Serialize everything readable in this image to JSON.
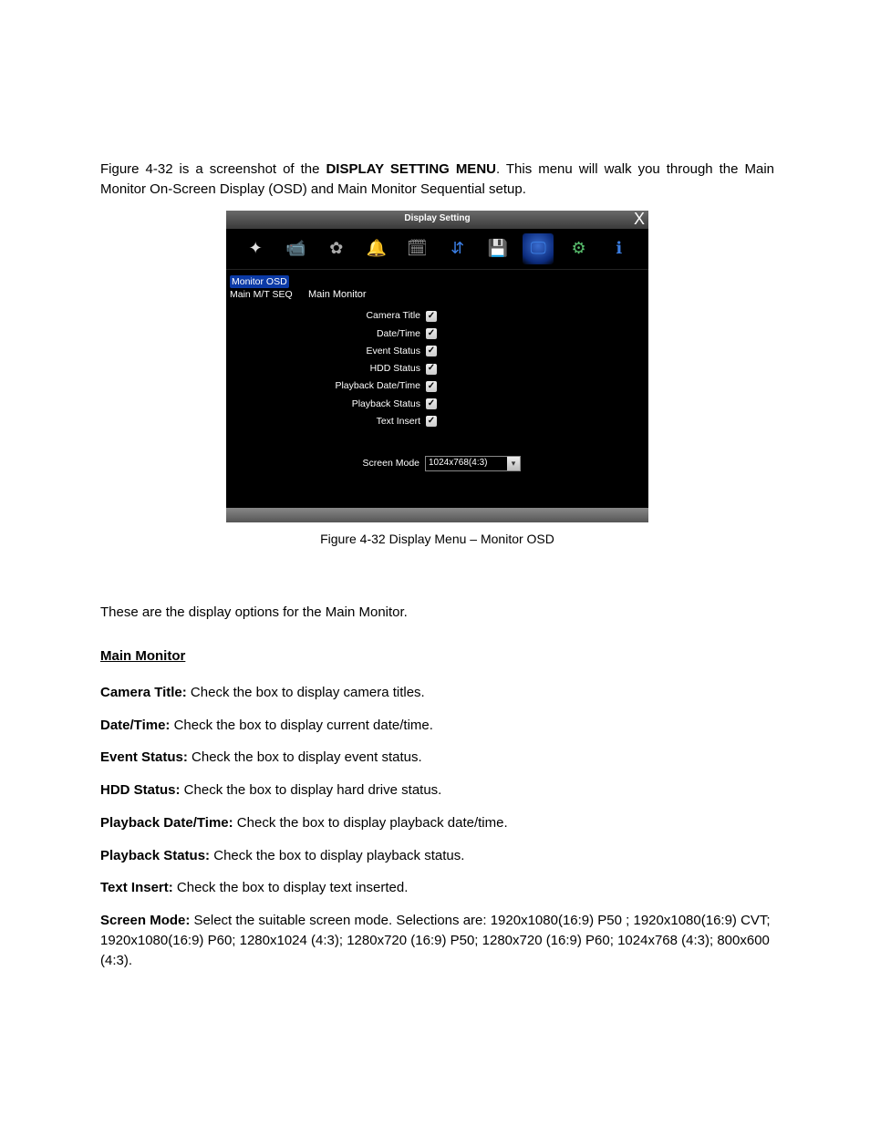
{
  "intro": {
    "prefix": "Figure 4-32 is a screenshot of the ",
    "bold": "DISPLAY SETTING MENU",
    "suffix": ". This menu will walk you through the Main Monitor On-Screen Display (OSD) and Main Monitor Sequential setup."
  },
  "app": {
    "title": "Display Setting",
    "close": "X",
    "sidebar": {
      "monitor_osd": "Monitor OSD",
      "main_mt_seq": "Main M/T SEQ"
    },
    "main_title": "Main Monitor",
    "options": {
      "camera_title": "Camera Title",
      "date_time": "Date/Time",
      "event_status": "Event Status",
      "hdd_status": "HDD Status",
      "playback_date_time": "Playback Date/Time",
      "playback_status": "Playback Status",
      "text_insert": "Text Insert"
    },
    "screen_mode_label": "Screen Mode",
    "screen_mode_value": "1024x768(4:3)"
  },
  "caption": "Figure 4-32 Display Menu – Monitor OSD",
  "para_intro": "These are the display options for the Main Monitor.",
  "heading": "Main Monitor",
  "defs": {
    "camera_title": {
      "label": "Camera Title:",
      "desc": " Check the box to display camera titles."
    },
    "date_time": {
      "label": "Date/Time:",
      "desc": " Check the box to display current date/time."
    },
    "event_status": {
      "label": "Event Status:",
      "desc": " Check the box to display event status."
    },
    "hdd_status": {
      "label": "HDD Status:",
      "desc": " Check the box to display hard drive status."
    },
    "playback_date_time": {
      "label": "Playback Date/Time:",
      "desc": " Check the box to display playback date/time."
    },
    "playback_status": {
      "label": "Playback Status:",
      "desc": " Check the box to display playback status."
    },
    "text_insert": {
      "label": "Text Insert:",
      "desc": " Check the box to display text inserted."
    },
    "screen_mode": {
      "label": "Screen Mode:",
      "desc": "  Select the suitable screen mode. Selections are: 1920x1080(16:9) P50 ;  1920x1080(16:9) CVT; 1920x1080(16:9) P60; 1280x1024 (4:3); 1280x720 (16:9) P50; 1280x720 (16:9) P60; 1024x768 (4:3); 800x600 (4:3)."
    }
  }
}
